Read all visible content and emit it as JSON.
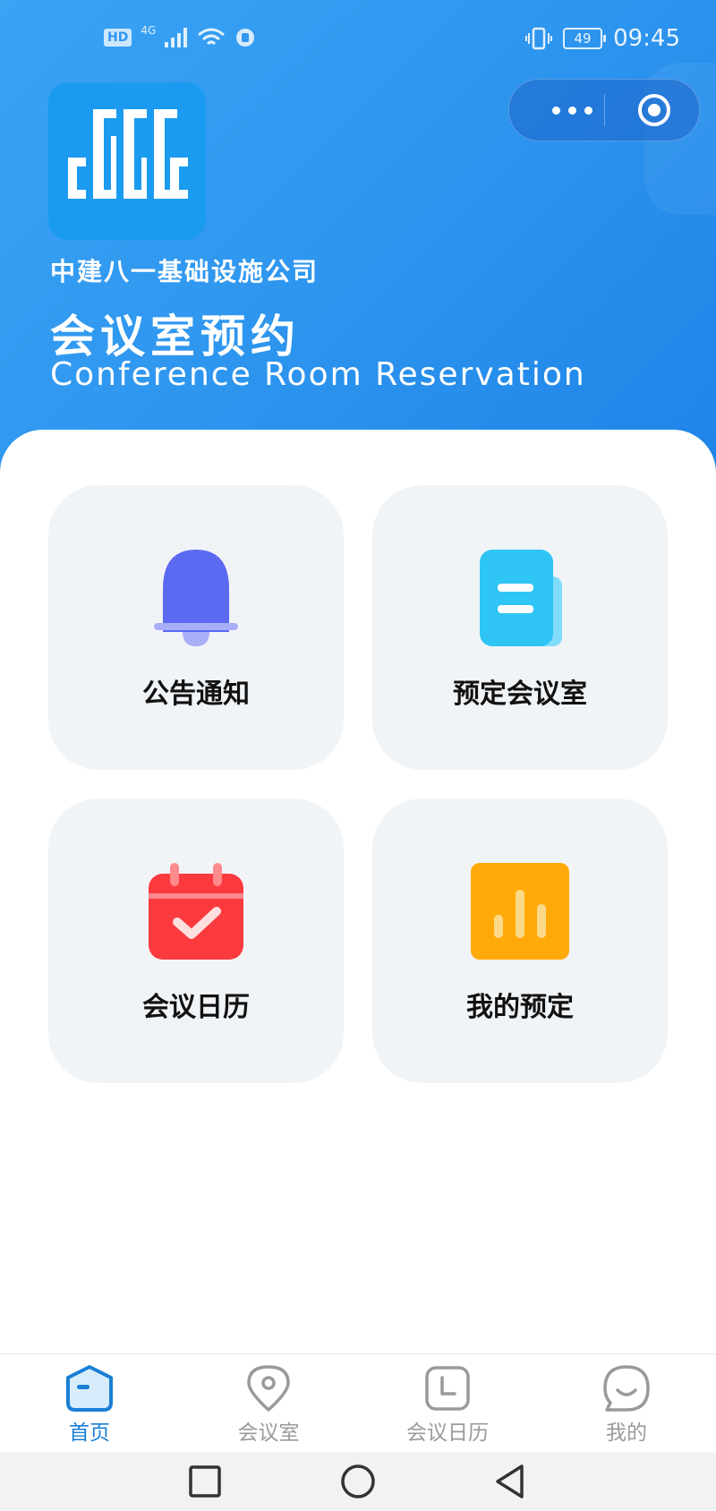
{
  "status_bar": {
    "hd": "HD",
    "network": "4G",
    "battery": "49",
    "time": "09:45"
  },
  "header": {
    "company": "中建八一基础设施公司",
    "title": "会议室预约",
    "subtitle": "Conference Room Reservation"
  },
  "capsule": {
    "more_icon": "more-dots-icon",
    "close_icon": "target-circle-icon"
  },
  "cards": [
    {
      "label": "公告通知",
      "icon": "bell-icon",
      "color": "#5b6af0"
    },
    {
      "label": "预定会议室",
      "icon": "document-icon",
      "color": "#2ec5f5"
    },
    {
      "label": "会议日历",
      "icon": "calendar-check-icon",
      "color": "#fb3a3e"
    },
    {
      "label": "我的预定",
      "icon": "bar-chart-icon",
      "color": "#ffaa08"
    }
  ],
  "tabbar": {
    "active_color": "#1a7fd6",
    "inactive_color": "#9a9a9a",
    "items": [
      {
        "label": "首页",
        "icon": "home-icon",
        "active": true
      },
      {
        "label": "会议室",
        "icon": "location-pin-icon",
        "active": false
      },
      {
        "label": "会议日历",
        "icon": "calendar-icon",
        "active": false
      },
      {
        "label": "我的",
        "icon": "smiley-chat-icon",
        "active": false
      }
    ]
  },
  "nav_bar": {
    "items": [
      "square-recent-icon",
      "circle-home-icon",
      "triangle-back-icon"
    ]
  }
}
